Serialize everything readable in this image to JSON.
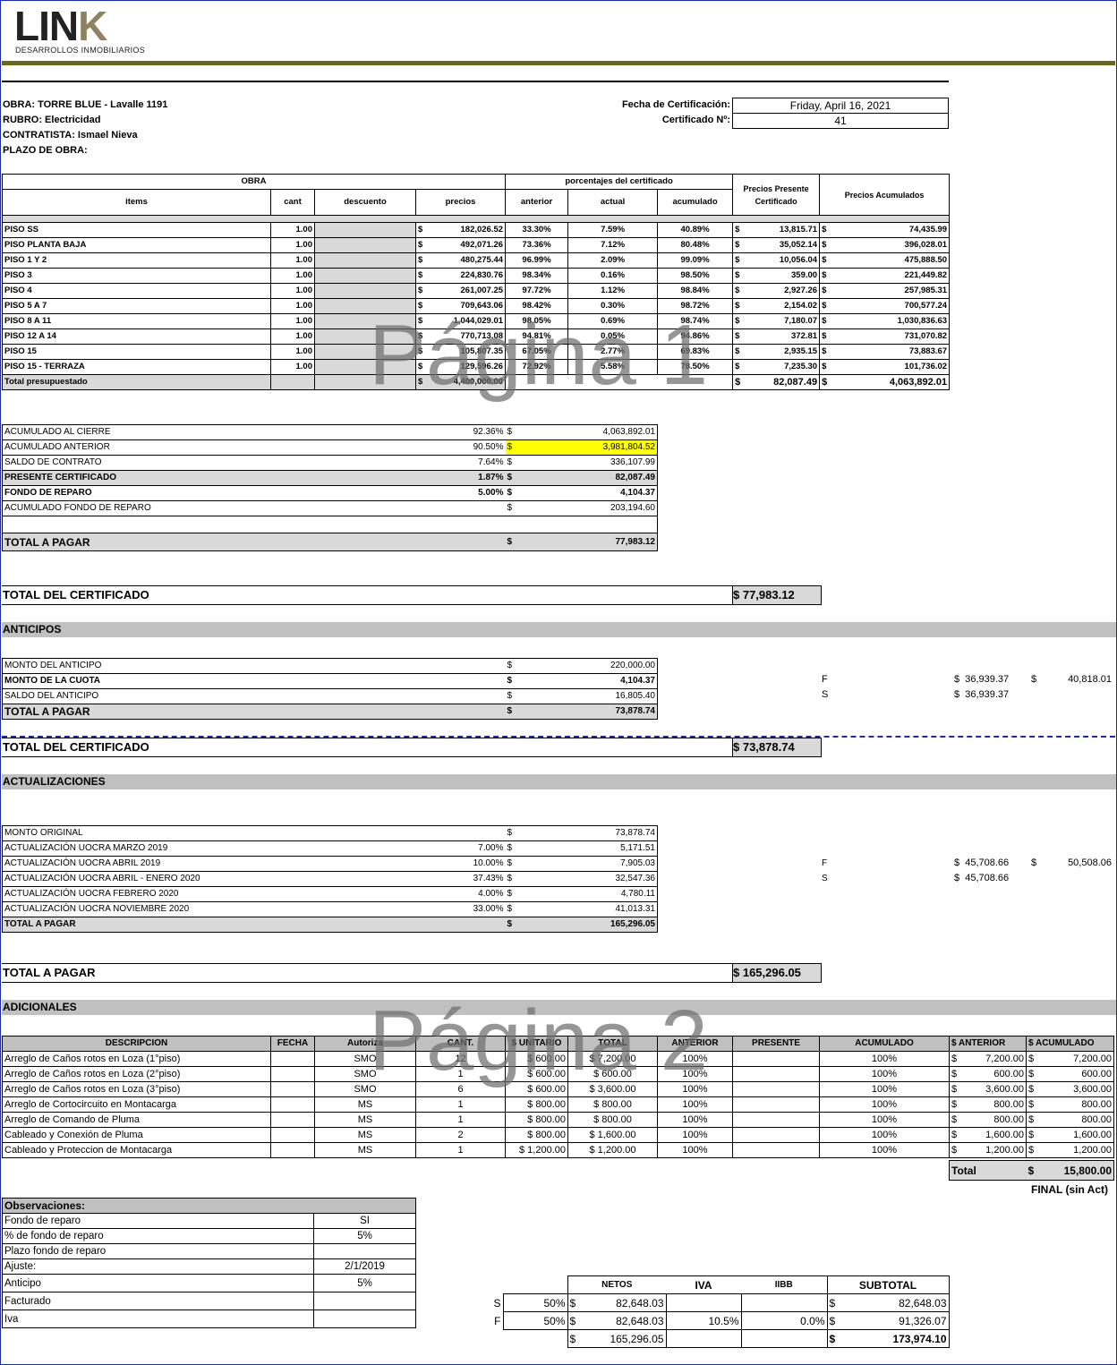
{
  "logo": {
    "text_main": "LIN",
    "text_k": "K",
    "subtitle": "DESARROLLOS INMOBILIARIOS"
  },
  "header": {
    "obra": "OBRA: TORRE BLUE - Lavalle 1191",
    "rubro": "RUBRO: Electricidad",
    "contratista": "CONTRATISTA: Ismael Nieva",
    "plazo": "PLAZO DE OBRA:",
    "fecha_label": "Fecha de Certificación:",
    "fecha_value": "Friday, April 16, 2021",
    "cert_label": "Certificado Nº:",
    "cert_value": "41"
  },
  "main_table": {
    "group_obra": "OBRA",
    "group_pct": "porcentajes del certificado",
    "col_items": "items",
    "col_cant": "cant",
    "col_desc": "descuento",
    "col_precios": "precios",
    "col_anterior": "anterior",
    "col_actual": "actual",
    "col_acumulado": "acumulado",
    "col_presente": "Precios Presente Certificado",
    "col_acum": "Precios Acumulados",
    "rows": [
      {
        "item": "PISO SS",
        "cant": "1.00",
        "precio": "182,026.52",
        "anterior": "33.30%",
        "actual": "7.59%",
        "acumulado": "40.89%",
        "presente": "13,815.71",
        "acum": "74,435.99"
      },
      {
        "item": "PISO PLANTA BAJA",
        "cant": "1.00",
        "precio": "492,071.26",
        "anterior": "73.36%",
        "actual": "7.12%",
        "acumulado": "80.48%",
        "presente": "35,052.14",
        "acum": "396,028.01"
      },
      {
        "item": "PISO 1 Y 2",
        "cant": "1.00",
        "precio": "480,275.44",
        "anterior": "96.99%",
        "actual": "2.09%",
        "acumulado": "99.09%",
        "presente": "10,056.04",
        "acum": "475,888.50"
      },
      {
        "item": "PISO 3",
        "cant": "1.00",
        "precio": "224,830.76",
        "anterior": "98.34%",
        "actual": "0.16%",
        "acumulado": "98.50%",
        "presente": "359.00",
        "acum": "221,449.82"
      },
      {
        "item": "PISO 4",
        "cant": "1.00",
        "precio": "261,007.25",
        "anterior": "97.72%",
        "actual": "1.12%",
        "acumulado": "98.84%",
        "presente": "2,927.26",
        "acum": "257,985.31"
      },
      {
        "item": "PISO 5 A 7",
        "cant": "1.00",
        "precio": "709,643.06",
        "anterior": "98.42%",
        "actual": "0.30%",
        "acumulado": "98.72%",
        "presente": "2,154.02",
        "acum": "700,577.24"
      },
      {
        "item": "PISO 8 A 11",
        "cant": "1.00",
        "precio": "1,044,029.01",
        "anterior": "98.05%",
        "actual": "0.69%",
        "acumulado": "98.74%",
        "presente": "7,180.07",
        "acum": "1,030,836.63"
      },
      {
        "item": "PISO 12 A 14",
        "cant": "1.00",
        "precio": "770,713.08",
        "anterior": "94.81%",
        "actual": "0.05%",
        "acumulado": "94.86%",
        "presente": "372.81",
        "acum": "731,070.82"
      },
      {
        "item": "PISO 15",
        "cant": "1.00",
        "precio": "105,807.35",
        "anterior": "67.05%",
        "actual": "2.77%",
        "acumulado": "69.83%",
        "presente": "2,935.15",
        "acum": "73,883.67"
      },
      {
        "item": "PISO 15 - TERRAZA",
        "cant": "1.00",
        "precio": "129,596.26",
        "anterior": "72.92%",
        "actual": "5.58%",
        "acumulado": "78.50%",
        "presente": "7,235.30",
        "acum": "101,736.02"
      }
    ],
    "total_label": "Total presupuestado",
    "total_precio": "4,400,000.00",
    "total_presente": "82,087.49",
    "total_acum": "4,063,892.01"
  },
  "summary": {
    "rows": [
      {
        "label": "ACUMULADO AL CIERRE",
        "pct": "92.36%",
        "val": "4,063,892.01",
        "bold": false
      },
      {
        "label": "ACUMULADO ANTERIOR",
        "pct": "90.50%",
        "val": "3,981,804.52",
        "bold": false
      },
      {
        "label": "SALDO DE CONTRATO",
        "pct": "7.64%",
        "val": "336,107.99",
        "bold": false
      },
      {
        "label": "PRESENTE CERTIFICADO",
        "pct": "1.87%",
        "val": "82,087.49",
        "bold": true
      },
      {
        "label": "FONDO DE REPARO",
        "pct": "5.00%",
        "val": "4,104.37",
        "bold": true
      },
      {
        "label": "ACUMULADO FONDO DE REPARO",
        "pct": "",
        "val": "203,194.60",
        "bold": false
      }
    ],
    "total_label": "TOTAL A PAGAR",
    "total_val": "77,983.12"
  },
  "total_cert_1": {
    "label": "TOTAL DEL CERTIFICADO",
    "value": "$  77,983.12"
  },
  "anticipos": {
    "title": "ANTICIPOS",
    "rows": [
      {
        "label": "MONTO DEL ANTICIPO",
        "val": "220,000.00",
        "bold": false
      },
      {
        "label": "MONTO DE LA CUOTA",
        "val": "4,104.37",
        "bold": true
      },
      {
        "label": "SALDO DEL ANTICIPO",
        "val": "16,805.40",
        "bold": false
      }
    ],
    "total_label": "TOTAL A PAGAR",
    "total_val": "73,878.74",
    "side_f": "F",
    "side_s": "S",
    "side_v1": "36,939.37",
    "side_v2": "36,939.37",
    "side_v3": "40,818.01"
  },
  "total_cert_2": {
    "label": "TOTAL DEL CERTIFICADO",
    "value": "$  73,878.74"
  },
  "actualizaciones": {
    "title": "ACTUALIZACIONES",
    "rows": [
      {
        "label": "MONTO ORIGINAL",
        "pct": "",
        "val": "73,878.74"
      },
      {
        "label": "ACTUALIZACIÓN UOCRA MARZO 2019",
        "pct": "7.00%",
        "val": "5,171.51"
      },
      {
        "label": "ACTUALIZACIÓN UOCRA ABRIL 2019",
        "pct": "10.00%",
        "val": "7,905.03"
      },
      {
        "label": "ACTUALIZACIÓN UOCRA ABRIL - ENERO 2020",
        "pct": "37.43%",
        "val": "32,547.36"
      },
      {
        "label": "ACTUALIZACIÓN UOCRA FEBRERO 2020",
        "pct": "4.00%",
        "val": "4,780.11"
      },
      {
        "label": "ACTUALIZACIÓN UOCRA NOVIEMBRE 2020",
        "pct": "33.00%",
        "val": "41,013.31"
      }
    ],
    "total_label": "TOTAL A PAGAR",
    "total_val": "165,296.05",
    "side_f": "F",
    "side_s": "S",
    "side_v1": "45,708.66",
    "side_v2": "45,708.66",
    "side_v3": "50,508.06"
  },
  "total_pagar": {
    "label": "TOTAL A PAGAR",
    "value": "$ 165,296.05"
  },
  "adicionales": {
    "title": "ADICIONALES",
    "headers": [
      "DESCRIPCION",
      "FECHA",
      "Autoriza",
      "CANT.",
      "$ UNITARIO",
      "TOTAL",
      "ANTERIOR",
      "PRESENTE",
      "ACUMULADO",
      "$ ANTERIOR",
      "$ ACUMULADO"
    ],
    "rows": [
      {
        "desc": "Arreglo de Caños rotos en Loza (1°piso)",
        "aut": "SMO",
        "cant": "12",
        "unit": "$ 600.00",
        "total": "$ 7,200.00",
        "ant": "100%",
        "acum": "100%",
        "sant": "7,200.00",
        "sacum": "7,200.00"
      },
      {
        "desc": "Arreglo de Caños rotos en Loza (2°piso)",
        "aut": "SMO",
        "cant": "1",
        "unit": "$ 600.00",
        "total": "$ 600.00",
        "ant": "100%",
        "acum": "100%",
        "sant": "600.00",
        "sacum": "600.00"
      },
      {
        "desc": "Arreglo de Caños rotos en Loza (3°piso)",
        "aut": "SMO",
        "cant": "6",
        "unit": "$ 600.00",
        "total": "$ 3,600.00",
        "ant": "100%",
        "acum": "100%",
        "sant": "3,600.00",
        "sacum": "3,600.00"
      },
      {
        "desc": "Arreglo de Cortocircuito en Montacarga",
        "aut": "MS",
        "cant": "1",
        "unit": "$ 800.00",
        "total": "$ 800.00",
        "ant": "100%",
        "acum": "100%",
        "sant": "800.00",
        "sacum": "800.00"
      },
      {
        "desc": "Arreglo de Comando de Pluma",
        "aut": "MS",
        "cant": "1",
        "unit": "$ 800.00",
        "total": "$ 800.00",
        "ant": "100%",
        "acum": "100%",
        "sant": "800.00",
        "sacum": "800.00"
      },
      {
        "desc": "Cableado y Conexión de Pluma",
        "aut": "MS",
        "cant": "2",
        "unit": "$ 800.00",
        "total": "$ 1,600.00",
        "ant": "100%",
        "acum": "100%",
        "sant": "1,600.00",
        "sacum": "1,600.00"
      },
      {
        "desc": "Cableado y Proteccion de Montacarga",
        "aut": "MS",
        "cant": "1",
        "unit": "$ 1,200.00",
        "total": "$ 1,200.00",
        "ant": "100%",
        "acum": "100%",
        "sant": "1,200.00",
        "sacum": "1,200.00"
      }
    ],
    "total_label": "Total",
    "total_val": "15,800.00",
    "final_label": "FINAL (sin Act)"
  },
  "observaciones": {
    "title": "Observaciones:",
    "rows": [
      {
        "label": "Fondo de reparo",
        "val": "SI"
      },
      {
        "label": "% de fondo de reparo",
        "val": "5%"
      },
      {
        "label": "Plazo fondo de reparo",
        "val": ""
      },
      {
        "label": "Ajuste:",
        "val": "2/1/2019"
      },
      {
        "label": "Anticipo",
        "val": "5%"
      },
      {
        "label": "Facturado",
        "val": ""
      },
      {
        "label": "Iva",
        "val": ""
      }
    ]
  },
  "netos": {
    "headers": [
      "NETOS",
      "IVA",
      "IIBB",
      "SUBTOTAL"
    ],
    "rows": [
      {
        "side": "S",
        "pct": "50%",
        "neto": "82,648.03",
        "iva": "",
        "iibb": "",
        "sub": "82,648.03"
      },
      {
        "side": "F",
        "pct": "50%",
        "neto": "82,648.03",
        "iva": "10.5%",
        "iibb": "0.0%",
        "sub": "91,326.07"
      }
    ],
    "total_neto": "165,296.05",
    "total_sub": "173,974.10"
  },
  "watermarks": {
    "p1": "Página 1",
    "p2": "Página 2"
  },
  "colors": {
    "olive_bar": "#6b6523",
    "logo_k": "#8f8262",
    "highlight": "#ffff00",
    "gray": "#c0c0c0"
  }
}
